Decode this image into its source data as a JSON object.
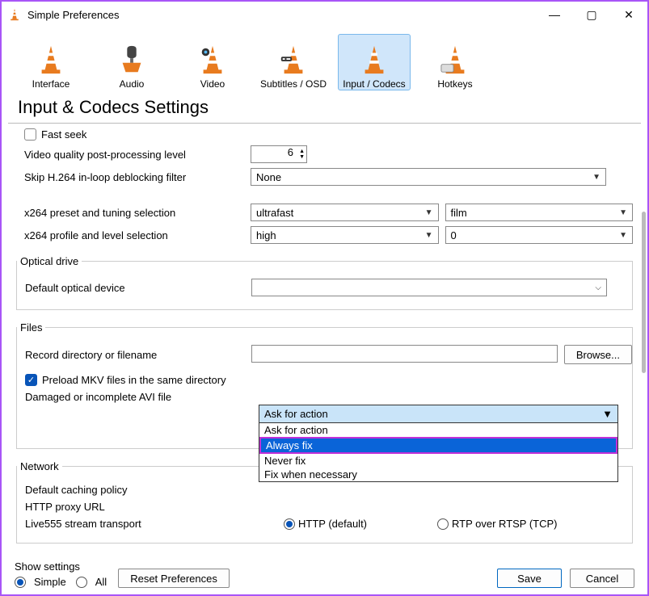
{
  "window": {
    "title": "Simple Preferences"
  },
  "toolbar": [
    {
      "id": "interface",
      "label": "Interface"
    },
    {
      "id": "audio",
      "label": "Audio"
    },
    {
      "id": "video",
      "label": "Video"
    },
    {
      "id": "subtitles",
      "label": "Subtitles / OSD"
    },
    {
      "id": "input-codecs",
      "label": "Input / Codecs",
      "selected": true
    },
    {
      "id": "hotkeys",
      "label": "Hotkeys"
    }
  ],
  "page_title": "Input & Codecs Settings",
  "top": {
    "fast_seek_label": "Fast seek",
    "vq_label": "Video quality post-processing level",
    "vq_value": "6",
    "skip_label": "Skip H.264 in-loop deblocking filter",
    "skip_value": "None",
    "x264_preset_label": "x264 preset and tuning selection",
    "x264_preset_value": "ultrafast",
    "x264_tuning_value": "film",
    "x264_profile_label": "x264 profile and level selection",
    "x264_profile_value": "high",
    "x264_level_value": "0"
  },
  "optical": {
    "legend": "Optical drive",
    "default_label": "Default optical device",
    "default_value": ""
  },
  "files": {
    "legend": "Files",
    "record_label": "Record directory or filename",
    "record_value": "",
    "browse_label": "Browse...",
    "preload_label": "Preload MKV files in the same directory",
    "avi_label": "Damaged or incomplete AVI file",
    "avi_value": "Ask for action",
    "avi_options": [
      "Ask for action",
      "Always fix",
      "Never fix",
      "Fix when necessary"
    ]
  },
  "network": {
    "legend": "Network",
    "caching_label": "Default caching policy",
    "proxy_label": "HTTP proxy URL",
    "live555_label": "Live555 stream transport",
    "http_label": "HTTP (default)",
    "rtp_label": "RTP over RTSP (TCP)"
  },
  "footer": {
    "show_settings_label": "Show settings",
    "simple_label": "Simple",
    "all_label": "All",
    "reset_label": "Reset Preferences",
    "save_label": "Save",
    "cancel_label": "Cancel"
  }
}
